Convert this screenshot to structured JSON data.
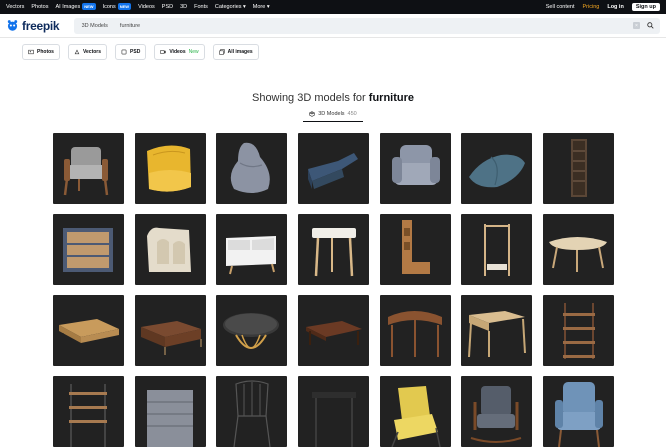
{
  "topbar": {
    "nav": [
      {
        "label": "Vectors"
      },
      {
        "label": "Photos"
      },
      {
        "label": "AI Images",
        "badge": "NEW"
      },
      {
        "label": "Icons",
        "badge": "NEW"
      },
      {
        "label": "Videos"
      },
      {
        "label": "PSD"
      },
      {
        "label": "3D"
      },
      {
        "label": "Fonts"
      },
      {
        "label": "Categories ▾"
      },
      {
        "label": "More ▾"
      }
    ],
    "sell": "Sell content",
    "pricing": "Pricing",
    "login": "Log in",
    "signup": "Sign up"
  },
  "header": {
    "logo": "freepik",
    "search_category": "3D Models",
    "search_value": "furniture"
  },
  "filters": [
    {
      "label": "Photos",
      "icon": "photo-icon"
    },
    {
      "label": "Vectors",
      "icon": "vector-icon"
    },
    {
      "label": "PSD",
      "icon": "psd-icon"
    },
    {
      "label": "Videos",
      "icon": "video-icon",
      "extra": "New"
    },
    {
      "label": "All images",
      "icon": "images-icon"
    }
  ],
  "results": {
    "prefix": "Showing 3D models for",
    "query": "furniture",
    "tab_label": "3D Models",
    "tab_count": "450"
  },
  "colors": {
    "accent": "#1273eb",
    "pricing": "#f6a821",
    "new": "#2db44b",
    "card_bg": "#222222"
  }
}
